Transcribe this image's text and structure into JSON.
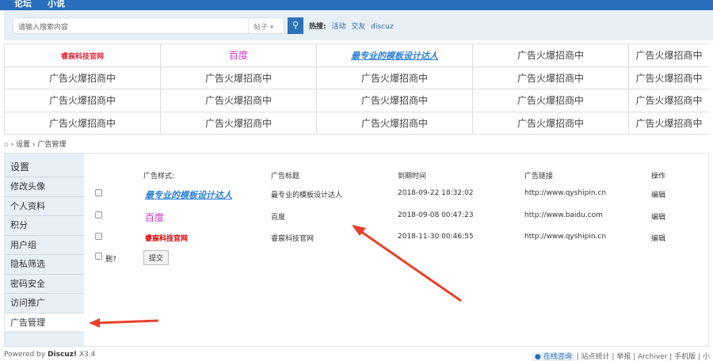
{
  "nav": {
    "items": [
      "论坛",
      "小说"
    ]
  },
  "search": {
    "placeholder": "请输入搜索内容",
    "type": "帖子",
    "hot_label": "热搜:",
    "hot": [
      "活动",
      "交友",
      "discuz"
    ]
  },
  "ads": [
    [
      "睿宸科技官网",
      "百度",
      "最专业的模板设计达人",
      "广告火爆招商中",
      "广告火爆招商中"
    ],
    [
      "广告火爆招商中",
      "广告火爆招商中",
      "广告火爆招商中",
      "广告火爆招商中",
      "广告火爆招商中"
    ],
    [
      "广告火爆招商中",
      "广告火爆招商中",
      "广告火爆招商中",
      "广告火爆招商中",
      "广告火爆招商中"
    ],
    [
      "广告火爆招商中",
      "广告火爆招商中",
      "广告火爆招商中",
      "广告火爆招商中",
      "广告火爆招商中"
    ]
  ],
  "breadcrumb": [
    "设置",
    "广告管理"
  ],
  "sidebar": {
    "title": "设置",
    "items": [
      "修改头像",
      "个人资料",
      "积分",
      "用户组",
      "隐私筛选",
      "密码安全",
      "访问推广",
      "广告管理"
    ]
  },
  "table": {
    "headers": [
      "广告样式:",
      "广告标题",
      "到期时间",
      "广告链接",
      "操作"
    ],
    "rows": [
      {
        "style": "最专业的模板设计达人",
        "title": "最专业的模板设计达人",
        "expire": "2018-09-22 18:32:02",
        "link": "http://www.qyshipin.cn",
        "op": "编辑"
      },
      {
        "style": "百度",
        "title": "百度",
        "expire": "2018-09-08 00:47:23",
        "link": "http://www.baidu.com",
        "op": "编辑"
      },
      {
        "style": "睿宸科技官网",
        "title": "睿宸科技官网",
        "expire": "2018-11-30 00:46:55",
        "link": "http://www.qyshipin.cn",
        "op": "编辑"
      }
    ],
    "delete_label": "删?",
    "submit": "提交"
  },
  "footer": {
    "powered": "Powered by ",
    "brand": "Discuz!",
    "version": " X3.4",
    "links": [
      "在线咨询",
      "站点统计",
      "举报",
      "Archiver",
      "手机版",
      "小"
    ]
  },
  "colors": {
    "nav": "#2a6fbe",
    "arrow": "#e8402a"
  }
}
